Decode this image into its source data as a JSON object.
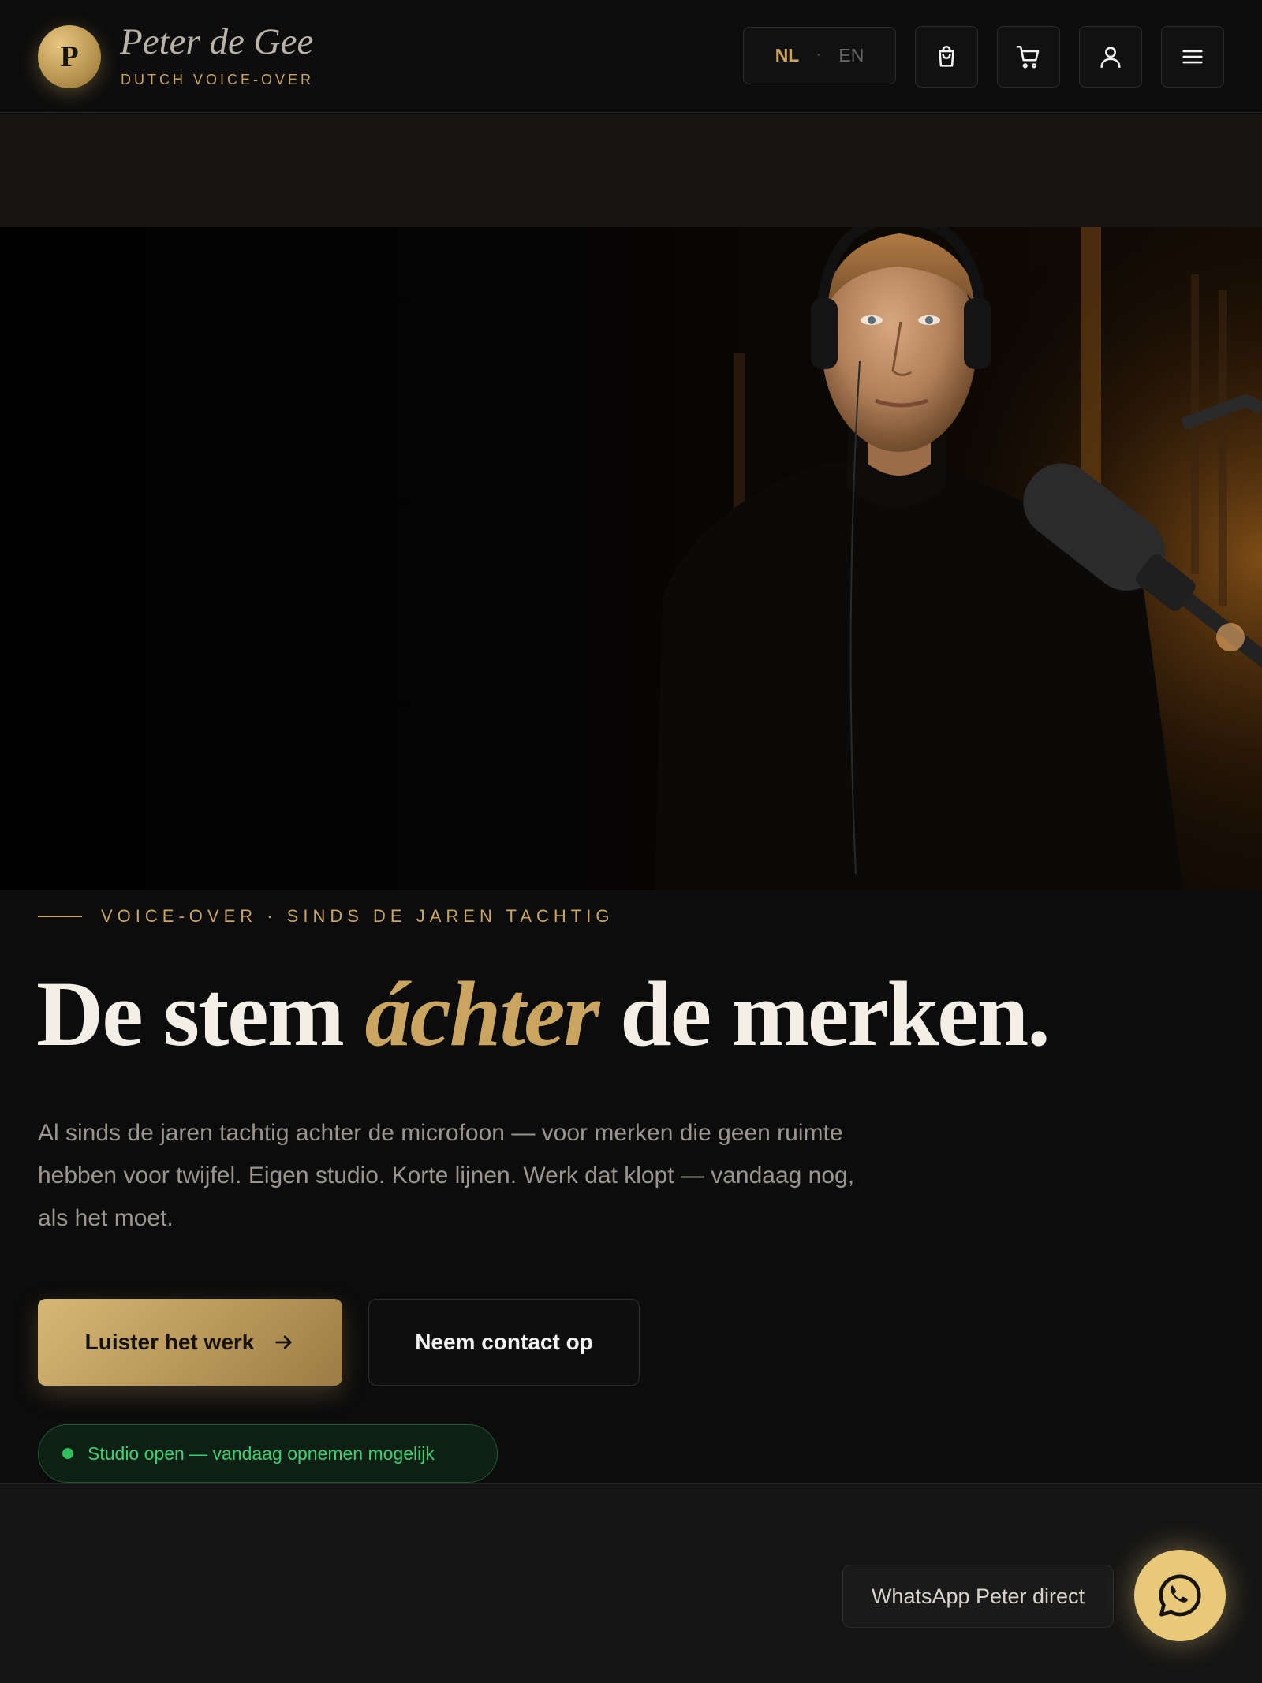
{
  "brand": {
    "badge_letter": "P",
    "name": "Peter de Gee",
    "tagline": "DUTCH VOICE-OVER"
  },
  "header": {
    "lang_active": "NL",
    "lang_separator": "·",
    "lang_other": "EN",
    "icons": [
      "shopping-bag-icon",
      "cart-icon",
      "user-icon",
      "menu-icon"
    ]
  },
  "hero": {
    "eyebrow": "VOICE-OVER · SINDS DE JAREN TACHTIG",
    "headline_before": "De stem ",
    "headline_accent": "áchter",
    "headline_after": " de merken.",
    "lead": "Al sinds de jaren tachtig achter de microfoon — voor merken die geen ruimte hebben voor twijfel. Eigen studio. Korte lijnen. Werk dat klopt — vandaag nog, als het moet.",
    "primary_cta": "Luister het werk",
    "secondary_cta": "Neem contact op",
    "status": "Studio open — vandaag opnemen mogelijk"
  },
  "whatsapp": {
    "label": "WhatsApp Peter direct"
  },
  "colors": {
    "accent_gold": "#c9a560",
    "status_green": "#3ecf74",
    "background": "#0c0c0c"
  }
}
